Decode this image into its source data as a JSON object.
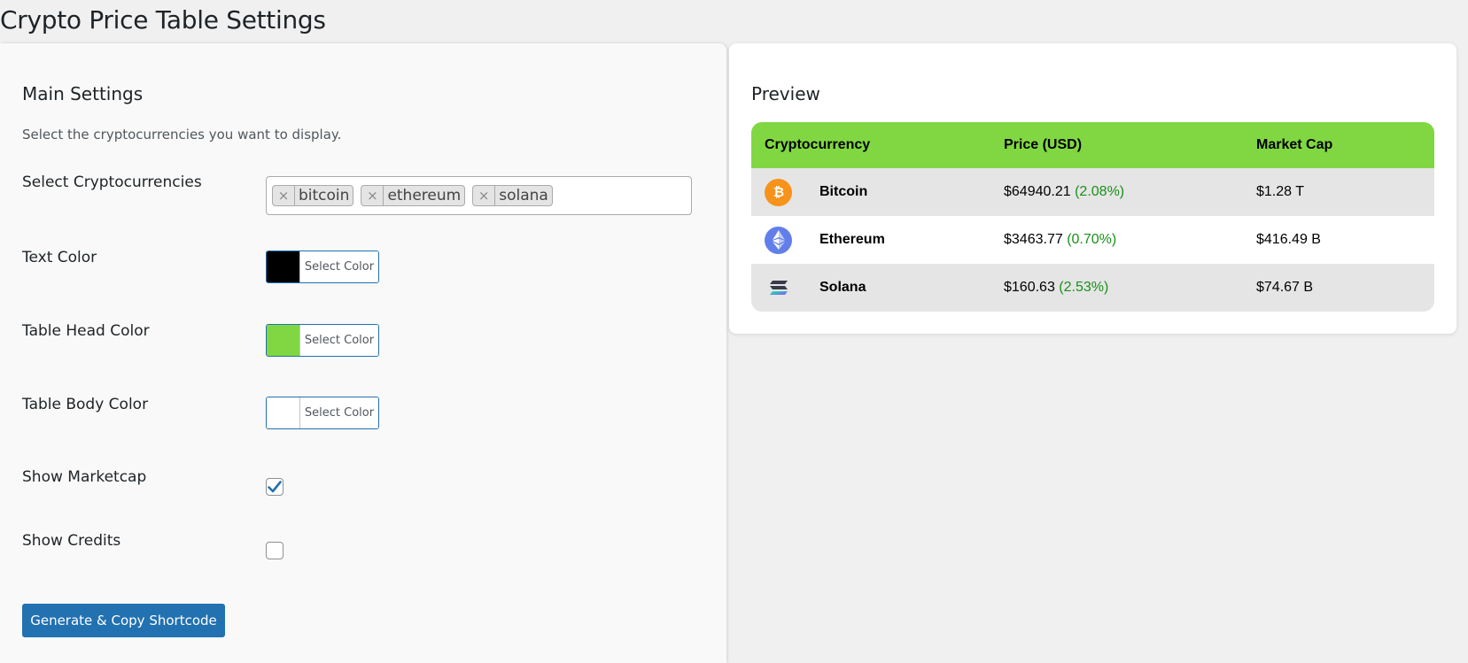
{
  "page": {
    "title": "Crypto Price Table Settings"
  },
  "settings": {
    "section_title": "Main Settings",
    "description": "Select the cryptocurrencies you want to display.",
    "select_crypto_label": "Select Cryptocurrencies",
    "selected_tags": [
      {
        "remove": "×",
        "label": "bitcoin"
      },
      {
        "remove": "×",
        "label": "ethereum"
      },
      {
        "remove": "×",
        "label": "solana"
      }
    ],
    "text_color": {
      "label": "Text Color",
      "button": "Select Color",
      "value": "#000000"
    },
    "head_color": {
      "label": "Table Head Color",
      "button": "Select Color",
      "value": "#81d742"
    },
    "body_color": {
      "label": "Table Body Color",
      "button": "Select Color",
      "value": "#ffffff"
    },
    "show_marketcap": {
      "label": "Show Marketcap",
      "checked": true
    },
    "show_credits": {
      "label": "Show Credits",
      "checked": false
    },
    "generate_button": "Generate & Copy Shortcode"
  },
  "preview": {
    "section_title": "Preview",
    "headers": [
      "Cryptocurrency",
      "Price (USD)",
      "Market Cap"
    ],
    "rows": [
      {
        "name": "Bitcoin",
        "icon": "bitcoin-icon",
        "price": "$64940.21",
        "change": "(2.08%)",
        "market_cap": "$1.28 T"
      },
      {
        "name": "Ethereum",
        "icon": "ethereum-icon",
        "price": "$3463.77",
        "change": "(0.70%)",
        "market_cap": "$416.49 B"
      },
      {
        "name": "Solana",
        "icon": "solana-icon",
        "price": "$160.63",
        "change": "(2.53%)",
        "market_cap": "$74.67 B"
      }
    ]
  },
  "colors": {
    "primary_button": "#2271b1",
    "table_head": "#81d742",
    "positive_change": "#1a8f1a",
    "bitcoin": "#f7931a",
    "ethereum": "#627eea"
  }
}
